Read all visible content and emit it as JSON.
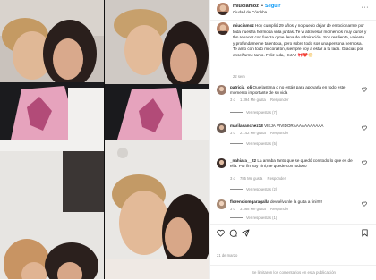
{
  "post": {
    "username": "miuciamoz",
    "follow_label": "Seguir",
    "separator": "•",
    "location": "Ciudad de Córdoba",
    "more_label": "···"
  },
  "caption": {
    "username": "miuciamoz",
    "text": "Hoy cumplió 29 años y no puedo dejar de emocionarme por toda nuestra hermosa vida juntas. Te vi atravesar momentos muy duros y tbn renacer con fuerza q me llena de admiración. Sos resiliente, valiente y profundamente talentosa, pero sobre todo sos una persona hermosa. Te amo con todo mi corazón, siempre voy a estar a tu lado. Gracias por enseñarme tanto. Feliz vida, HIJA ! 🎀❤️🌕",
    "time": "22 sem"
  },
  "comments": [
    {
      "username": "patricia_oli",
      "text": "Que lastima q no estás para apoyarla en todo este momento importante de su vida",
      "time": "3 d",
      "likes": "1.394 Me gusta",
      "reply": "Responder",
      "replies": "Ver respuestas (7)"
    },
    {
      "username": "marilasanchez18",
      "text": "VIEJA VIVIDORAAAAAAAAAAA",
      "time": "3 d",
      "likes": "2.142 Me gusta",
      "reply": "Responder",
      "replies": "Ver respuestas (5)"
    },
    {
      "username": "_nahiara__22",
      "text": "La amaba tanto que se quedó con todo lo que es de ella. Por fin soy Tini,me quede con todooo",
      "time": "3 d",
      "likes": "785 Me gusta",
      "reply": "Responder",
      "replies": "Ver respuestas (2)"
    },
    {
      "username": "florenciomgaragalla",
      "text": "devuélvanle la guita a tini!!!!!",
      "time": "3 d",
      "likes": "3.368 Me gusta",
      "reply": "Responder",
      "replies": "Ver respuestas (1)"
    }
  ],
  "actions": {
    "like_icon": "heart-icon",
    "comment_icon": "comment-icon",
    "share_icon": "share-icon",
    "save_icon": "bookmark-icon"
  },
  "date": "21 de marzo",
  "footer": "Se limitaron los comentarios en esta publicación",
  "colors": {
    "link_blue": "#0095f6",
    "muted_text": "#8e8e8e",
    "border": "#efefef",
    "shirt_pink": "#e6a3bd"
  }
}
